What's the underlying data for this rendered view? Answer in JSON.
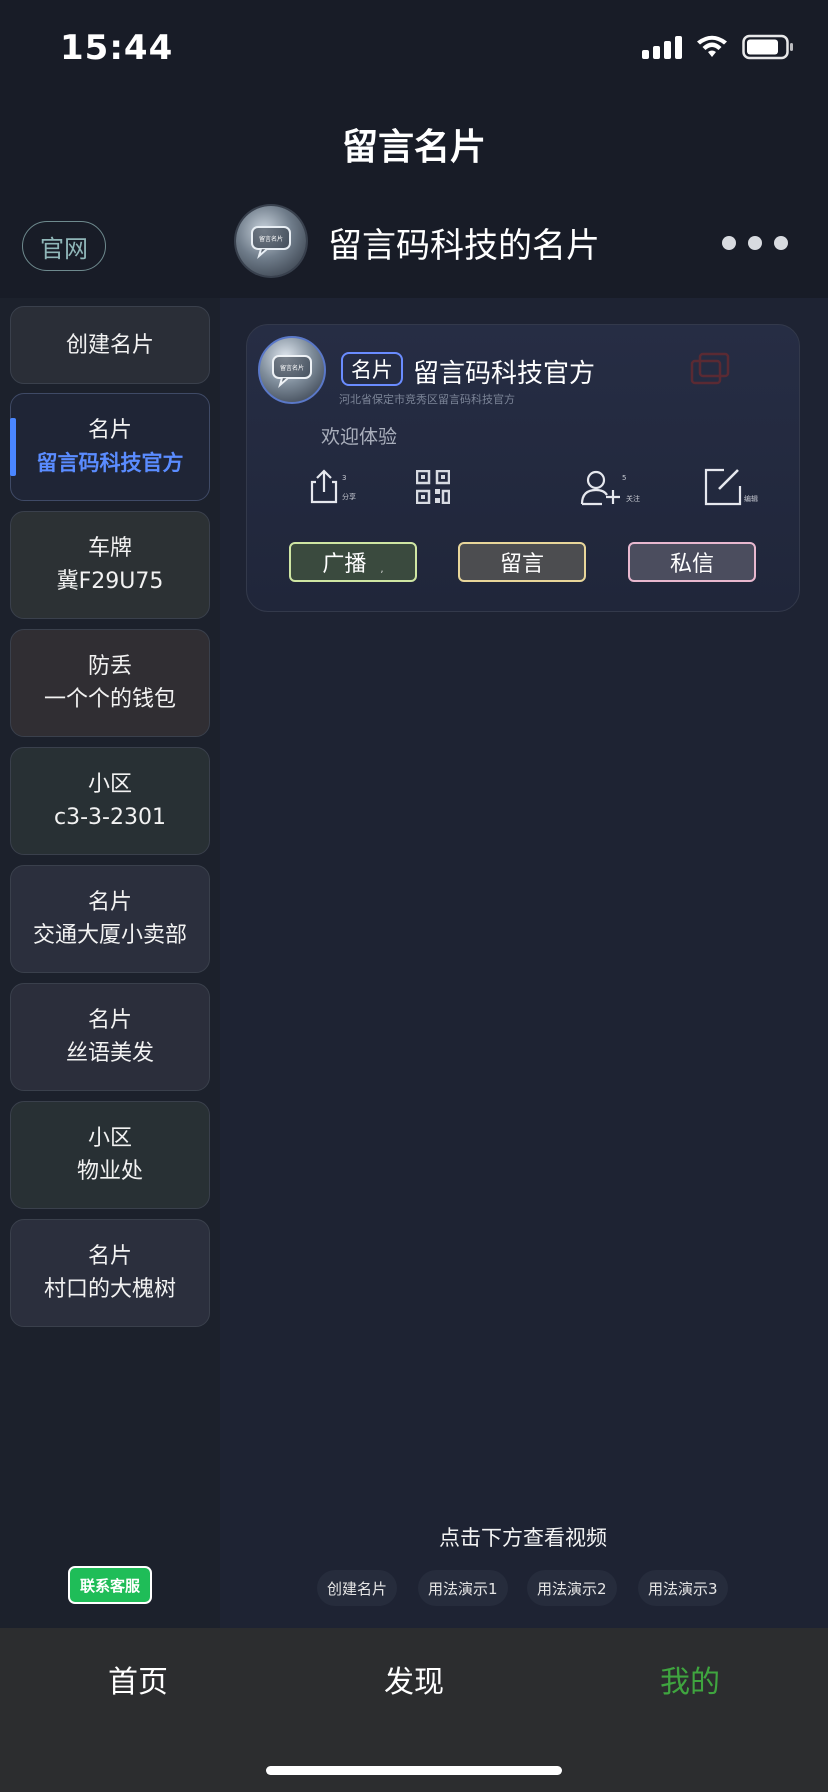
{
  "status": {
    "time": "15:44"
  },
  "nav": {
    "title": "留言名片"
  },
  "header": {
    "official_label": "官网",
    "avatar_text": "留言名片",
    "title": "留言码科技的名片"
  },
  "sidebar": {
    "create_label": "创建名片",
    "items": [
      {
        "type": "名片",
        "name": "留言码科技官方"
      },
      {
        "type": "车牌",
        "name": "冀F29U75"
      },
      {
        "type": "防丢",
        "name": "一个个的钱包"
      },
      {
        "type": "小区",
        "name": "c3-3-2301"
      },
      {
        "type": "名片",
        "name": "交通大厦小卖部"
      },
      {
        "type": "名片",
        "name": "丝语美发"
      },
      {
        "type": "小区",
        "name": "物业处"
      },
      {
        "type": "名片",
        "name": "村口的大槐树"
      }
    ],
    "contact_label": "联系客服"
  },
  "card": {
    "avatar_text": "留言名片",
    "tag": "名片",
    "name": "留言码科技官方",
    "address": "河北省保定市竞秀区留言码科技官方",
    "welcome": "欢迎体验",
    "share": {
      "count": "3",
      "caption": "分享"
    },
    "follow": {
      "count": "5",
      "caption": "关注"
    },
    "edit_caption": "编辑",
    "buttons": {
      "broadcast": "广播",
      "broadcast_mark": ",",
      "message": "留言",
      "private": "私信"
    }
  },
  "videos": {
    "hint": "点击下方查看视频",
    "chips": [
      "创建名片",
      "用法演示1",
      "用法演示2",
      "用法演示3"
    ]
  },
  "tabbar": {
    "home": "首页",
    "discover": "发现",
    "mine": "我的"
  },
  "colors": {
    "accent_blue": "#4a86ff",
    "active_tab_green": "#3fa53f",
    "contact_green": "#1fbd58"
  }
}
